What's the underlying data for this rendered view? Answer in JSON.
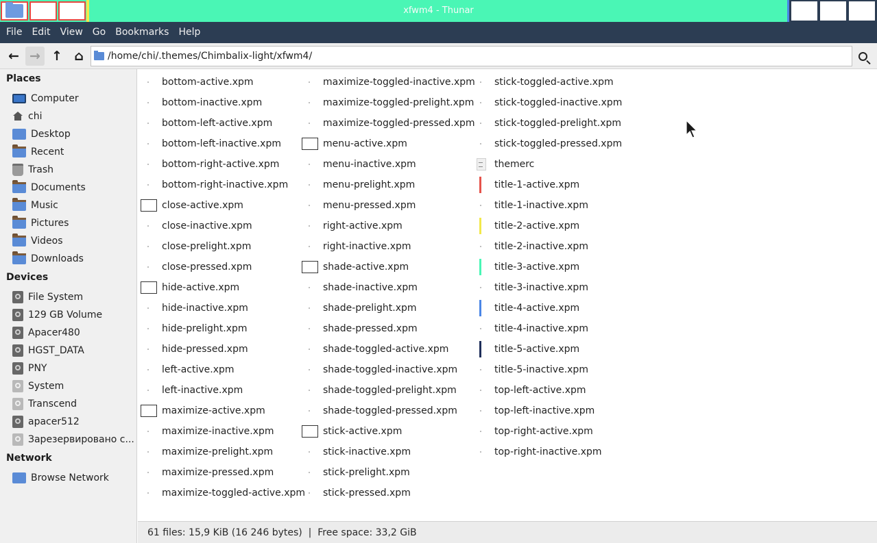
{
  "window": {
    "title": "xfwm4 - Thunar"
  },
  "menubar": {
    "items": [
      "File",
      "Edit",
      "View",
      "Go",
      "Bookmarks",
      "Help"
    ]
  },
  "toolbar": {
    "back_icon": "arrow-left-icon",
    "forward_icon": "arrow-right-icon",
    "up_icon": "arrow-up-icon",
    "home_icon": "home-icon",
    "location": "/home/chi/.themes/Chimbalix-light/xfwm4/",
    "search_icon": "search-icon"
  },
  "sidebar": {
    "places_title": "Places",
    "places": [
      {
        "label": "Computer",
        "icon": "computer-icon"
      },
      {
        "label": "chi",
        "icon": "home-icon"
      },
      {
        "label": "Desktop",
        "icon": "desktop-folder-icon"
      },
      {
        "label": "Recent",
        "icon": "recent-folder-icon"
      },
      {
        "label": "Trash",
        "icon": "trash-icon"
      },
      {
        "label": "Documents",
        "icon": "folder-icon"
      },
      {
        "label": "Music",
        "icon": "music-folder-icon"
      },
      {
        "label": "Pictures",
        "icon": "pictures-folder-icon"
      },
      {
        "label": "Videos",
        "icon": "videos-folder-icon"
      },
      {
        "label": "Downloads",
        "icon": "downloads-folder-icon"
      }
    ],
    "devices_title": "Devices",
    "devices": [
      {
        "label": "File System",
        "icon": "drive-icon"
      },
      {
        "label": "129 GB Volume",
        "icon": "drive-icon"
      },
      {
        "label": "Apacer480",
        "icon": "drive-icon"
      },
      {
        "label": "HGST_DATA",
        "icon": "drive-icon"
      },
      {
        "label": "PNY",
        "icon": "drive-icon"
      },
      {
        "label": "System",
        "icon": "drive-icon"
      },
      {
        "label": "Transcend",
        "icon": "drive-icon"
      },
      {
        "label": "apacer512",
        "icon": "drive-icon"
      },
      {
        "label": "Зарезервировано с...",
        "icon": "drive-icon"
      }
    ],
    "network_title": "Network",
    "network": [
      {
        "label": "Browse Network",
        "icon": "network-folder-icon"
      }
    ]
  },
  "files": {
    "columns": [
      [
        {
          "name": "bottom-active.xpm",
          "thumb": "dot"
        },
        {
          "name": "bottom-inactive.xpm",
          "thumb": "dot"
        },
        {
          "name": "bottom-left-active.xpm",
          "thumb": "dot"
        },
        {
          "name": "bottom-left-inactive.xpm",
          "thumb": "dot"
        },
        {
          "name": "bottom-right-active.xpm",
          "thumb": "dot"
        },
        {
          "name": "bottom-right-inactive.xpm",
          "thumb": "dot"
        },
        {
          "name": "close-active.xpm",
          "thumb": "box"
        },
        {
          "name": "close-inactive.xpm",
          "thumb": "dot"
        },
        {
          "name": "close-prelight.xpm",
          "thumb": "dot"
        },
        {
          "name": "close-pressed.xpm",
          "thumb": "dot"
        },
        {
          "name": "hide-active.xpm",
          "thumb": "box"
        },
        {
          "name": "hide-inactive.xpm",
          "thumb": "dot"
        },
        {
          "name": "hide-prelight.xpm",
          "thumb": "dot"
        },
        {
          "name": "hide-pressed.xpm",
          "thumb": "dot"
        },
        {
          "name": "left-active.xpm",
          "thumb": "dot"
        },
        {
          "name": "left-inactive.xpm",
          "thumb": "dot"
        },
        {
          "name": "maximize-active.xpm",
          "thumb": "box"
        },
        {
          "name": "maximize-inactive.xpm",
          "thumb": "dot"
        },
        {
          "name": "maximize-prelight.xpm",
          "thumb": "dot"
        },
        {
          "name": "maximize-pressed.xpm",
          "thumb": "dot"
        },
        {
          "name": "maximize-toggled-active.xpm",
          "thumb": "dot"
        }
      ],
      [
        {
          "name": "maximize-toggled-inactive.xpm",
          "thumb": "dot"
        },
        {
          "name": "maximize-toggled-prelight.xpm",
          "thumb": "dot"
        },
        {
          "name": "maximize-toggled-pressed.xpm",
          "thumb": "dot"
        },
        {
          "name": "menu-active.xpm",
          "thumb": "box"
        },
        {
          "name": "menu-inactive.xpm",
          "thumb": "dot"
        },
        {
          "name": "menu-prelight.xpm",
          "thumb": "dot"
        },
        {
          "name": "menu-pressed.xpm",
          "thumb": "dot"
        },
        {
          "name": "right-active.xpm",
          "thumb": "dot"
        },
        {
          "name": "right-inactive.xpm",
          "thumb": "dot"
        },
        {
          "name": "shade-active.xpm",
          "thumb": "box"
        },
        {
          "name": "shade-inactive.xpm",
          "thumb": "dot"
        },
        {
          "name": "shade-prelight.xpm",
          "thumb": "dot"
        },
        {
          "name": "shade-pressed.xpm",
          "thumb": "dot"
        },
        {
          "name": "shade-toggled-active.xpm",
          "thumb": "dot"
        },
        {
          "name": "shade-toggled-inactive.xpm",
          "thumb": "dot"
        },
        {
          "name": "shade-toggled-prelight.xpm",
          "thumb": "dot"
        },
        {
          "name": "shade-toggled-pressed.xpm",
          "thumb": "dot"
        },
        {
          "name": "stick-active.xpm",
          "thumb": "box"
        },
        {
          "name": "stick-inactive.xpm",
          "thumb": "dot"
        },
        {
          "name": "stick-prelight.xpm",
          "thumb": "dot"
        },
        {
          "name": "stick-pressed.xpm",
          "thumb": "dot"
        }
      ],
      [
        {
          "name": "stick-toggled-active.xpm",
          "thumb": "dot"
        },
        {
          "name": "stick-toggled-inactive.xpm",
          "thumb": "dot"
        },
        {
          "name": "stick-toggled-prelight.xpm",
          "thumb": "dot"
        },
        {
          "name": "stick-toggled-pressed.xpm",
          "thumb": "dot"
        },
        {
          "name": "themerc",
          "thumb": "doc"
        },
        {
          "name": "title-1-active.xpm",
          "thumb": "bar",
          "color": "#e5534b"
        },
        {
          "name": "title-1-inactive.xpm",
          "thumb": "dot"
        },
        {
          "name": "title-2-active.xpm",
          "thumb": "bar",
          "color": "#f2e84b"
        },
        {
          "name": "title-2-inactive.xpm",
          "thumb": "dot"
        },
        {
          "name": "title-3-active.xpm",
          "thumb": "bar",
          "color": "#4af6b5"
        },
        {
          "name": "title-3-inactive.xpm",
          "thumb": "dot"
        },
        {
          "name": "title-4-active.xpm",
          "thumb": "bar",
          "color": "#4b86e6"
        },
        {
          "name": "title-4-inactive.xpm",
          "thumb": "dot"
        },
        {
          "name": "title-5-active.xpm",
          "thumb": "bar",
          "color": "#1f2f5a"
        },
        {
          "name": "title-5-inactive.xpm",
          "thumb": "dot"
        },
        {
          "name": "top-left-active.xpm",
          "thumb": "dot"
        },
        {
          "name": "top-left-inactive.xpm",
          "thumb": "dot"
        },
        {
          "name": "top-right-active.xpm",
          "thumb": "dot"
        },
        {
          "name": "top-right-inactive.xpm",
          "thumb": "dot"
        }
      ]
    ]
  },
  "statusbar": {
    "text": "61 files: 15,9 KiB (16 246 bytes)  |  Free space: 33,2 GiB"
  },
  "colors": {
    "titlebar": "#4af6b5",
    "menubar": "#2c3d53",
    "accent_red": "#e5534b",
    "accent_yellow": "#f2e84b",
    "accent_blue": "#4b86e6"
  }
}
